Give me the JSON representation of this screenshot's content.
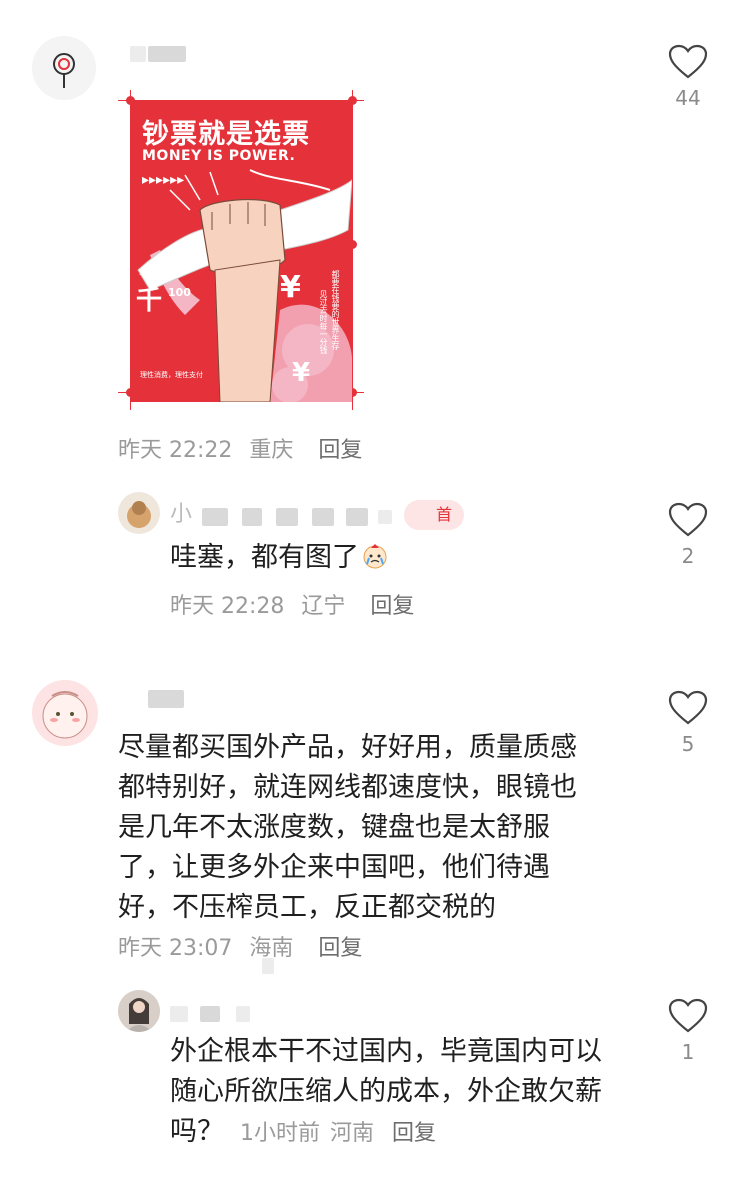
{
  "comments": [
    {
      "meta": {
        "time": "昨天 22:22",
        "location": "重庆",
        "reply": "回复"
      },
      "likes": "44",
      "image": {
        "title_cn": "钞票就是选票",
        "title_en": "MONEY IS POWER.",
        "side_text": "都要在钱要的世界生存",
        "side_text2": "见过去时每一分钱",
        "bottom_text": "理性消费，理性支付",
        "yuan": "¥",
        "qian": "千",
        "note": "100"
      },
      "replies": [
        {
          "text": "哇塞，都有图了",
          "meta": {
            "time": "昨天 22:28",
            "location": "辽宁",
            "reply": "回复"
          },
          "likes": "2",
          "name_prefix": "小",
          "badge": "首"
        }
      ]
    },
    {
      "text": "尽量都买国外产品，好好用，质量质感都特别好，就连网线都速度快，眼镜也是几年不太涨度数，键盘也是太舒服了，让更多外企来中国吧，他们待遇好，不压榨员工，反正都交税的",
      "lines": [
        "尽量都买国外产品，好好用，质量质感",
        "都特别好，就连网线都速度快，眼镜也",
        "是几年不太涨度数，键盘也是太舒服",
        "了，让更多外企来中国吧，他们待遇",
        "好，不压榨员工，反正都交税的"
      ],
      "meta": {
        "time": "昨天 23:07",
        "location": "海南",
        "reply": "回复"
      },
      "likes": "5",
      "replies": [
        {
          "lines": [
            "外企根本干不过国内，毕竟国内可以",
            "随心所欲压缩人的成本，外企敢欠薪",
            "吗？"
          ],
          "meta": {
            "time": "1小时前",
            "location": "河南",
            "reply": "回复"
          },
          "likes": "1"
        }
      ]
    }
  ],
  "colors": {
    "poster_red": "#e5323a",
    "meta_gray": "#9a9a9a",
    "heart_outline": "#444444"
  },
  "icons": [
    "heart-icon",
    "crying-emoji-icon",
    "lollipop-avatar-icon"
  ]
}
